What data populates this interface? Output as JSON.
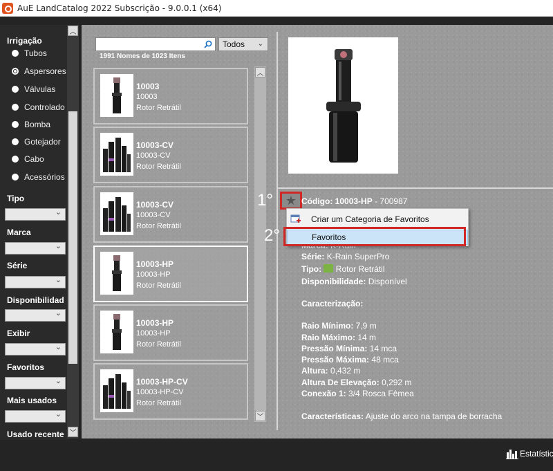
{
  "window": {
    "title": "AuE LandCatalog 2022 Subscrição - 9.0.0.1 (x64)"
  },
  "sidebar": {
    "irrigacao_header": "Irrigação",
    "radios": [
      {
        "label": "Tubos",
        "selected": false
      },
      {
        "label": "Aspersores",
        "selected": true
      },
      {
        "label": "Válvulas",
        "selected": false
      },
      {
        "label": "Controlado",
        "selected": false
      },
      {
        "label": "Bomba",
        "selected": false
      },
      {
        "label": "Gotejador",
        "selected": false
      },
      {
        "label": "Cabo",
        "selected": false
      },
      {
        "label": "Acessórios",
        "selected": false
      }
    ],
    "filters": [
      "Tipo",
      "Marca",
      "Série",
      "Disponibilidad",
      "Exibir",
      "Favoritos",
      "Mais usados",
      "Usado recente"
    ]
  },
  "search": {
    "placeholder": "",
    "filter_value": "Todos",
    "count_text": "1991 Nomes de 1023 Itens"
  },
  "items": [
    {
      "code": "10003",
      "sub": "10003",
      "type": "Rotor Retrátil"
    },
    {
      "code": "10003-CV",
      "sub": "10003-CV",
      "type": "Rotor Retrátil"
    },
    {
      "code": "10003-CV",
      "sub": "10003-CV",
      "type": "Rotor Retrátil"
    },
    {
      "code": "10003-HP",
      "sub": "10003-HP",
      "type": "Rotor Retrátil"
    },
    {
      "code": "10003-HP",
      "sub": "10003-HP",
      "type": "Rotor Retrátil"
    },
    {
      "code": "10003-HP-CV",
      "sub": "10003-HP-CV",
      "type": "Rotor Retrátil"
    }
  ],
  "steps": {
    "one": "1°",
    "two": "2°"
  },
  "details": {
    "code_label": "Código:",
    "code_value": "10003-HP",
    "code_suffix": "- 700987",
    "brand_label": "Marca:",
    "brand_value": "K-Rain",
    "series_label": "Série:",
    "series_value": "K-Rain SuperPro",
    "type_label": "Tipo:",
    "type_value": "Rotor Retrátil",
    "avail_label": "Disponibilidade:",
    "avail_value": "Disponível",
    "caracterizacao": "Caracterização:",
    "specs": [
      {
        "label": "Raio Mínimo:",
        "value": "7,9 m"
      },
      {
        "label": "Raio Máximo:",
        "value": "14 m"
      },
      {
        "label": "Pressão Mínima:",
        "value": "14 mca"
      },
      {
        "label": "Pressão Máxima:",
        "value": "48 mca"
      },
      {
        "label": "Altura:",
        "value": "0,432 m"
      },
      {
        "label": "Altura De Elevação:",
        "value": "0,292 m"
      },
      {
        "label": "Conexão 1:",
        "value": "3/4 Rosca Fêmea"
      }
    ],
    "features_label": "Características:",
    "features_value": "Ajuste do arco na tampa de borracha"
  },
  "menu": {
    "item1": "Criar um Categoria de Favoritos",
    "item2": "Favoritos"
  },
  "bottom": {
    "stats_label": "Estatístic"
  },
  "colors": {
    "highlight": "#d02727",
    "menu_selected": "#cce4f7"
  }
}
